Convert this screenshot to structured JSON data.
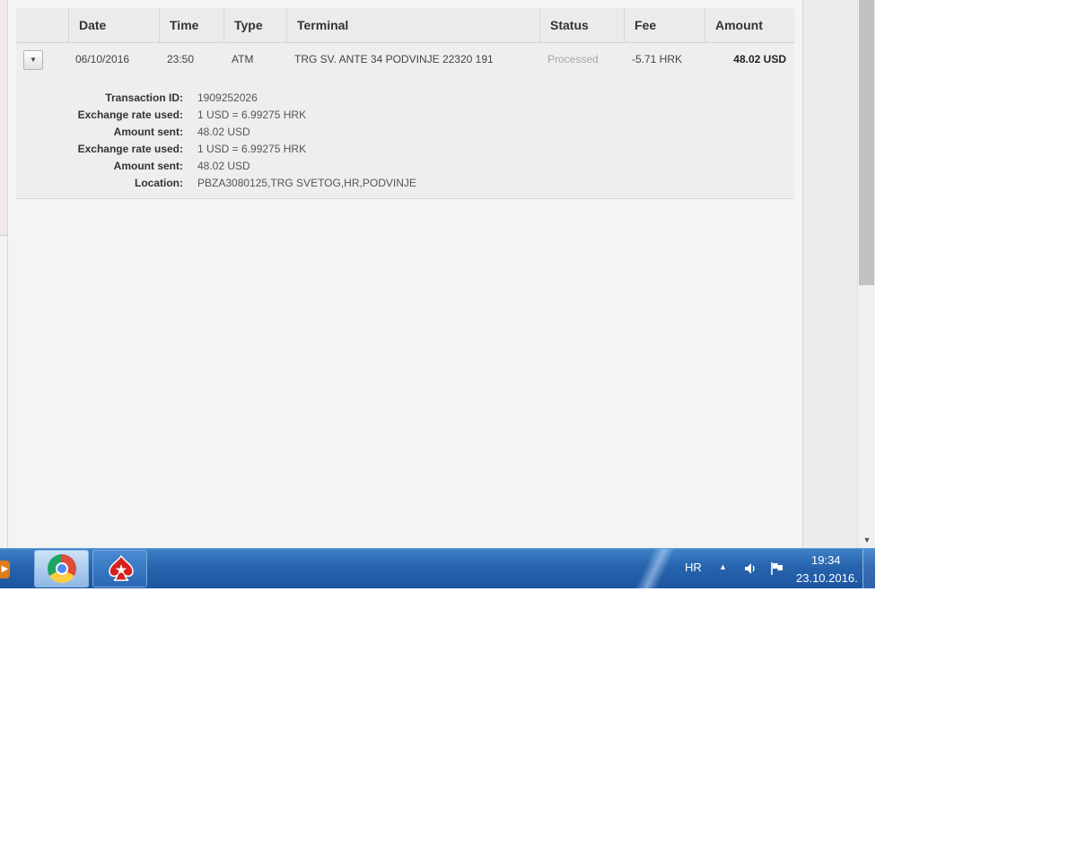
{
  "table": {
    "headers": [
      "Date",
      "Time",
      "Type",
      "Terminal",
      "Status",
      "Fee",
      "Amount"
    ],
    "row": {
      "date": "06/10/2016",
      "time": "23:50",
      "type": "ATM",
      "terminal": "TRG SV. ANTE 34 PODVINJE 22320 191",
      "status": "Processed",
      "fee": "-5.71 HRK",
      "amount": "48.02 USD"
    },
    "details": [
      {
        "label": "Transaction ID:",
        "value": "1909252026"
      },
      {
        "label": "Exchange rate used:",
        "value": "1 USD = 6.99275 HRK"
      },
      {
        "label": "Amount sent:",
        "value": "48.02 USD"
      },
      {
        "label": "Exchange rate used:",
        "value": "1 USD = 6.99275 HRK"
      },
      {
        "label": "Amount sent:",
        "value": "48.02 USD"
      },
      {
        "label": "Location:",
        "value": "PBZA3080125,TRG SVETOG,HR,PODVINJE"
      }
    ]
  },
  "taskbar": {
    "apps": [
      "chrome-icon",
      "pokerstars-icon"
    ],
    "language": "HR",
    "time": "19:34",
    "date": "23.10.2016."
  },
  "colors": {
    "status_processed": "#a8a8a8",
    "taskbar": "#2763ad"
  }
}
